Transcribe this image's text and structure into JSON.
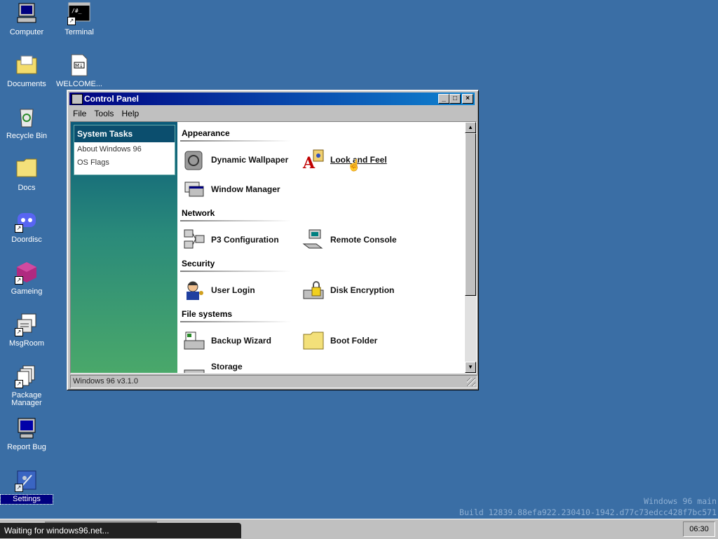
{
  "desktop": {
    "icons": [
      {
        "label": "Computer",
        "icon": "computer-icon"
      },
      {
        "label": "Terminal",
        "icon": "terminal-icon"
      },
      {
        "label": "Documents",
        "icon": "documents-folder-icon"
      },
      {
        "label": "WELCOME...",
        "icon": "markdown-file-icon"
      },
      {
        "label": "Recycle Bin",
        "icon": "recycle-bin-icon"
      },
      {
        "label": "Docs",
        "icon": "folder-icon"
      },
      {
        "label": "Doordisc",
        "icon": "doordisc-icon"
      },
      {
        "label": "Gameing",
        "icon": "game-cube-icon"
      },
      {
        "label": "MsgRoom",
        "icon": "chat-icon"
      },
      {
        "label": "Package Manager",
        "icon": "package-icon"
      },
      {
        "label": "Report Bug",
        "icon": "bug-report-icon"
      },
      {
        "label": "Settings",
        "icon": "settings-icon"
      }
    ],
    "build_line1": "Windows 96 main",
    "build_line2": "Build 12839.88efa922.230410-1942.d77c73edcc428f7bc571"
  },
  "window": {
    "title": "Control Panel",
    "menu": [
      "File",
      "Tools",
      "Help"
    ],
    "tasks": {
      "heading": "System Tasks",
      "links": [
        "About Windows 96",
        "OS Flags"
      ]
    },
    "sections": [
      {
        "heading": "Appearance",
        "items": [
          {
            "label": "Dynamic Wallpaper",
            "icon": "wallpaper-icon"
          },
          {
            "label": "Look and Feel",
            "icon": "look-and-feel-icon"
          },
          {
            "label": "Window Manager",
            "icon": "window-manager-icon"
          }
        ]
      },
      {
        "heading": "Network",
        "items": [
          {
            "label": "P3 Configuration",
            "icon": "network-config-icon"
          },
          {
            "label": "Remote Console",
            "icon": "remote-console-icon"
          }
        ]
      },
      {
        "heading": "Security",
        "items": [
          {
            "label": "User Login",
            "icon": "user-login-icon"
          },
          {
            "label": "Disk Encryption",
            "icon": "disk-encryption-icon"
          }
        ]
      },
      {
        "heading": "File systems",
        "items": [
          {
            "label": "Backup Wizard",
            "icon": "backup-wizard-icon"
          },
          {
            "label": "Boot Folder",
            "icon": "boot-folder-icon"
          },
          {
            "label": "Storage",
            "icon": "storage-icon"
          }
        ]
      }
    ],
    "status": "Windows 96 v3.1.0"
  },
  "taskbar": {
    "clock": "06:30",
    "loading": "Waiting for windows96.net..."
  },
  "colors": {
    "desktop": "#3a6ea5",
    "titlebar": "#000080",
    "task_header": "#0b4e6e"
  }
}
